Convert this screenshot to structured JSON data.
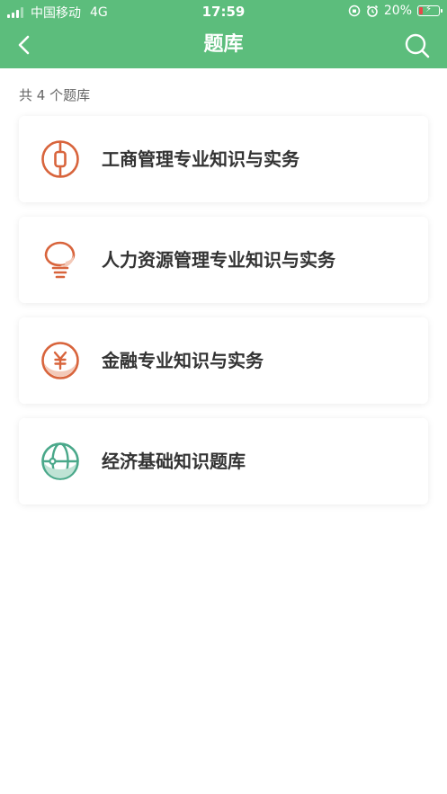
{
  "status": {
    "carrier": "中国移动",
    "network": "4G",
    "time": "17:59",
    "battery": "20%"
  },
  "nav": {
    "title": "题库",
    "back_icon": "chevron-left-icon",
    "search_icon": "search-icon"
  },
  "colors": {
    "header": "#5cbd7c",
    "accent_orange": "#d8643c",
    "accent_green": "#4aa88a"
  },
  "list": {
    "count_label": "共 4 个题库",
    "items": [
      {
        "label": "工商管理专业知识与实务",
        "icon": "coin-icon"
      },
      {
        "label": "人力资源管理专业知识与实务",
        "icon": "lightbulb-icon"
      },
      {
        "label": "金融专业知识与实务",
        "icon": "yen-icon"
      },
      {
        "label": "经济基础知识题库",
        "icon": "globe-icon"
      }
    ]
  }
}
